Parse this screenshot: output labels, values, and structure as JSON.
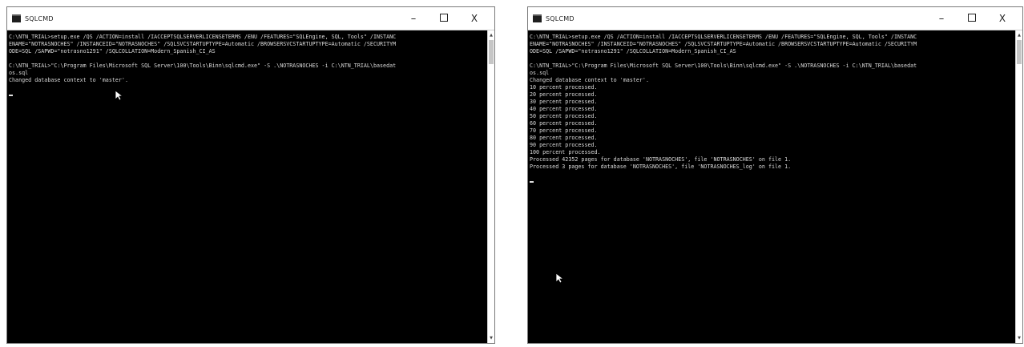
{
  "left_window": {
    "title": "SQLCMD",
    "controls": {
      "minimize": "–",
      "close": "X"
    },
    "lines": [
      "C:\\NTN_TRIAL>setup.exe /QS /ACTION=install /IACCEPTSQLSERVERLICENSETERMS /ENU /FEATURES=\"SQLEngine, SQL, Tools\" /INSTANC",
      "ENAME=\"NOTRASNOCHES\" /INSTANCEID=\"NOTRASNOCHES\" /SQLSVCSTARTUPTYPE=Automatic /BROWSERSVCSTARTUPTYPE=Automatic /SECURITYM",
      "ODE=SQL /SAPWD=\"notrasno1291\" /SQLCOLLATION=Modern_Spanish_CI_AS",
      "",
      "C:\\NTN_TRIAL>\"C:\\Program Files\\Microsoft SQL Server\\100\\Tools\\Binn\\sqlcmd.exe\" -S .\\NOTRASNOCHES -i C:\\NTN_TRIAL\\basedat",
      "os.sql",
      "Changed database context to 'master'."
    ]
  },
  "right_window": {
    "title": "SQLCMD",
    "controls": {
      "minimize": "–",
      "close": "X"
    },
    "lines": [
      "C:\\NTN_TRIAL>setup.exe /QS /ACTION=install /IACCEPTSQLSERVERLICENSETERMS /ENU /FEATURES=\"SQLEngine, SQL, Tools\" /INSTANC",
      "ENAME=\"NOTRASNOCHES\" /INSTANCEID=\"NOTRASNOCHES\" /SQLSVCSTARTUPTYPE=Automatic /BROWSERSVCSTARTUPTYPE=Automatic /SECURITYM",
      "ODE=SQL /SAPWD=\"notrasno1291\" /SQLCOLLATION=Modern_Spanish_CI_AS",
      "",
      "C:\\NTN_TRIAL>\"C:\\Program Files\\Microsoft SQL Server\\100\\Tools\\Binn\\sqlcmd.exe\" -S .\\NOTRASNOCHES -i C:\\NTN_TRIAL\\basedat",
      "os.sql",
      "Changed database context to 'master'.",
      "10 percent processed.",
      "20 percent processed.",
      "30 percent processed.",
      "40 percent processed.",
      "50 percent processed.",
      "60 percent processed.",
      "70 percent processed.",
      "80 percent processed.",
      "90 percent processed.",
      "100 percent processed.",
      "Processed 42352 pages for database 'NOTRASNOCHES', file 'NOTRASNOCHES' on file 1.",
      "Processed 3 pages for database 'NOTRASNOCHES', file 'NOTRASNOCHES_log' on file 1."
    ]
  },
  "colors": {
    "console_bg": "#000000",
    "console_text": "#d9d9d9",
    "titlebar_bg": "#ffffff"
  }
}
